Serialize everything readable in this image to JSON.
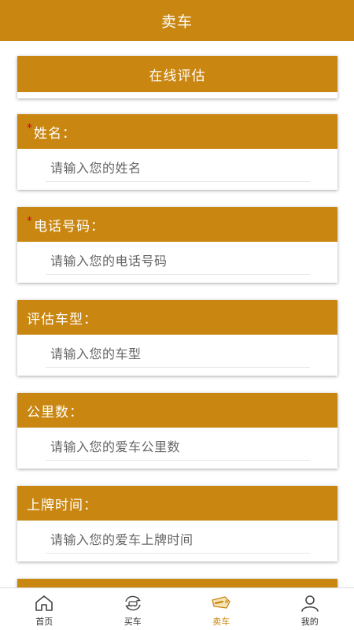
{
  "header": {
    "title": "卖车"
  },
  "evaluation": {
    "title": "在线评估"
  },
  "fields": [
    {
      "label": "姓名：",
      "required": true,
      "placeholder": "请输入您的姓名"
    },
    {
      "label": "电话号码：",
      "required": true,
      "placeholder": "请输入您的电话号码"
    },
    {
      "label": "评估车型：",
      "required": false,
      "placeholder": "请输入您的车型"
    },
    {
      "label": "公里数：",
      "required": false,
      "placeholder": "请输入您的爱车公里数"
    },
    {
      "label": "上牌时间：",
      "required": false,
      "placeholder": "请输入您的爱车上牌时间"
    }
  ],
  "required_mark": "*",
  "tabbar": {
    "items": [
      {
        "label": "首页",
        "icon": "home-icon"
      },
      {
        "label": "买车",
        "icon": "car-exchange-icon"
      },
      {
        "label": "卖车",
        "icon": "sale-tag-icon",
        "active": true
      },
      {
        "label": "我的",
        "icon": "user-icon"
      }
    ]
  },
  "colors": {
    "brand": "#c98712",
    "required": "#d0021b"
  }
}
